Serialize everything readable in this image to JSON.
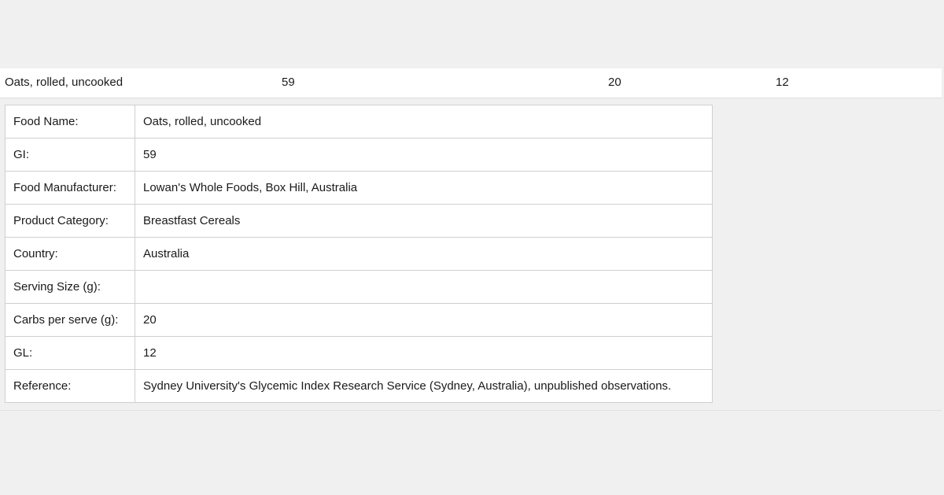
{
  "summary": {
    "food_name": "Oats, rolled, uncooked",
    "gi": "59",
    "carbs": "20",
    "gl": "12"
  },
  "details": {
    "rows": [
      {
        "label": "Food Name:",
        "value": "Oats, rolled, uncooked"
      },
      {
        "label": "GI:",
        "value": "59"
      },
      {
        "label": "Food Manufacturer:",
        "value": "Lowan's Whole Foods, Box Hill, Australia"
      },
      {
        "label": "Product Category:",
        "value": "Breastfast Cereals"
      },
      {
        "label": "Country:",
        "value": "Australia"
      },
      {
        "label": "Serving Size (g):",
        "value": ""
      },
      {
        "label": "Carbs per serve (g):",
        "value": "20"
      },
      {
        "label": "GL:",
        "value": "12"
      },
      {
        "label": "Reference:",
        "value": "Sydney University's Glycemic Index Research Service (Sydney, Australia), unpublished observations."
      }
    ]
  }
}
